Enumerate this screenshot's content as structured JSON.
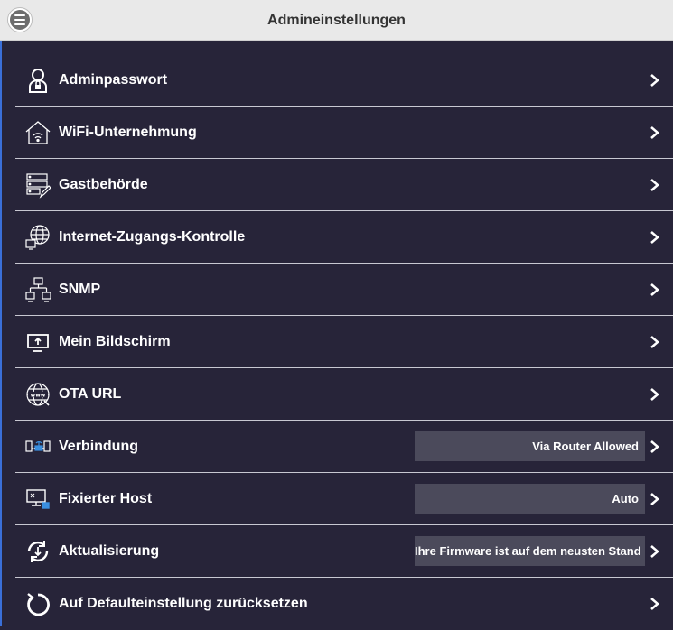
{
  "header": {
    "title": "Admineinstellungen"
  },
  "menu": [
    {
      "name": "adminpasswort",
      "label": "Adminpasswort",
      "icon": "user-lock-icon"
    },
    {
      "name": "wifi-unternehmung",
      "label": "WiFi-Unternehmung",
      "icon": "wifi-house-icon"
    },
    {
      "name": "gastbehoerde",
      "label": "Gastbehörde",
      "icon": "server-edit-icon"
    },
    {
      "name": "internet-zugangs-kontrolle",
      "label": "Internet-Zugangs-Kontrolle",
      "icon": "globe-monitor-icon"
    },
    {
      "name": "snmp",
      "label": "SNMP",
      "icon": "network-icon"
    },
    {
      "name": "mein-bildschirm",
      "label": "Mein Bildschirm",
      "icon": "screen-upload-icon"
    },
    {
      "name": "ota-url",
      "label": "OTA URL",
      "icon": "www-globe-icon"
    },
    {
      "name": "verbindung",
      "label": "Verbindung",
      "icon": "router-connection-icon",
      "value": "Via Router Allowed"
    },
    {
      "name": "fixierter-host",
      "label": "Fixierter Host",
      "icon": "host-monitor-icon",
      "value": "Auto"
    },
    {
      "name": "aktualisierung",
      "label": "Aktualisierung",
      "icon": "refresh-icon",
      "value": "Ihre Firmware ist auf dem neusten Stand"
    },
    {
      "name": "defaulteinstellung",
      "label": "Auf Defaulteinstellung zurücksetzen",
      "icon": "reset-icon"
    }
  ]
}
